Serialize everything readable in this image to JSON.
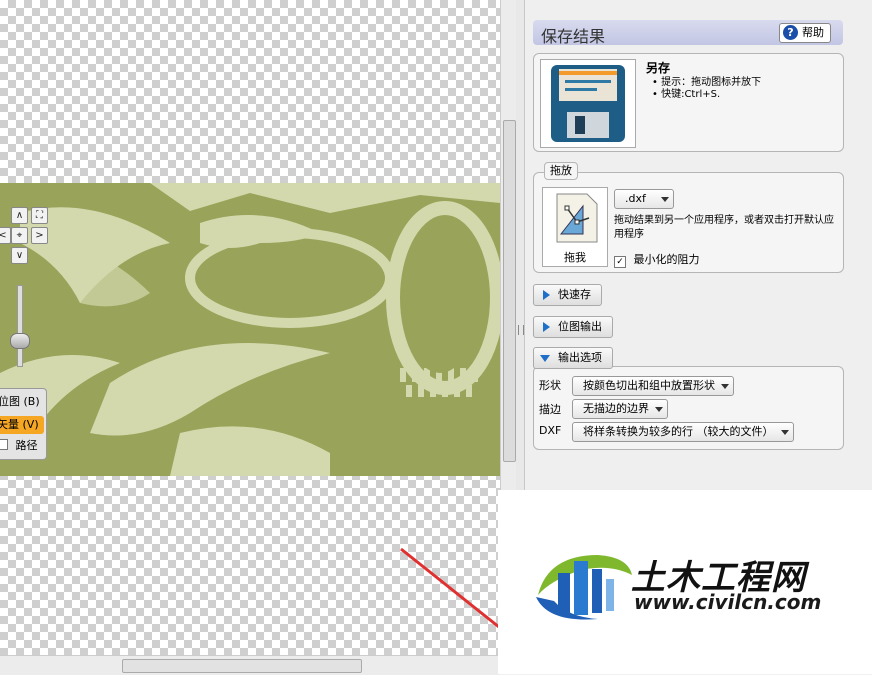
{
  "canvas": {
    "mode_buttons": [
      {
        "label": "位图 (B)",
        "selected": false
      },
      {
        "label": "矢量 (V)",
        "selected": true
      },
      {
        "label": "路径",
        "selected": false,
        "checkbox": true
      }
    ],
    "nav": {
      "up": "∧",
      "down": "∨",
      "left": "<",
      "right": ">",
      "center": "⌖",
      "fit": "⛶"
    }
  },
  "panel": {
    "title": "保存结果",
    "help_label": "帮助",
    "save_as": {
      "title": "另存",
      "hints": [
        "提示：拖动图标并放下",
        "快键:Ctrl+S."
      ]
    },
    "drag_drop": {
      "legend": "拖放",
      "icon_label": "拖我",
      "format": ".dxf",
      "description": "拖动结果到另一个应用程序，或者双击打开默认应用程序",
      "minimize_label": "最小化的阻力",
      "minimize_checked": true
    },
    "quick_save_label": "快速存",
    "bitmap_output_label": "位图输出",
    "output_options": {
      "label": "输出选项",
      "rows": [
        {
          "label": "形状",
          "value": "按颜色切出和组中放置形状"
        },
        {
          "label": "描边",
          "value": "无描边的边界"
        },
        {
          "label": "DXF",
          "value": "将样条转换为较多的行 （较大的文件）"
        }
      ]
    }
  },
  "watermark": {
    "name": "土木工程网",
    "url": "www.civilcn.com"
  },
  "colors": {
    "artwork_dark": "#9aa35a",
    "artwork_light": "#d3d9ad",
    "selected_mode": "#f5a623",
    "accent": "#1f6fc9"
  }
}
